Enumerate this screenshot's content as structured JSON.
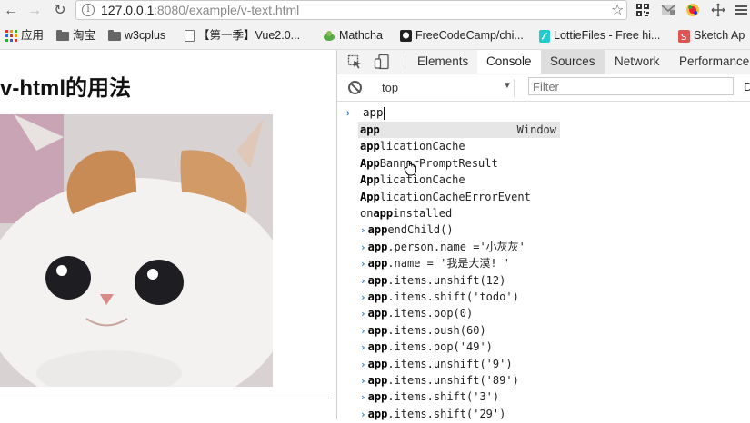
{
  "toolbar": {
    "back_glyph": "←",
    "forward_glyph": "→",
    "reload_glyph": "↻",
    "info_glyph": "i",
    "url_host": "127.0.0.1",
    "url_rest": ":8080/example/v-text.html",
    "star_glyph": "☆",
    "extensions": [
      "qr-code-icon",
      "gmail-icon",
      "color-picker-icon",
      "move-icon",
      "menu-icon"
    ]
  },
  "bookmarks": [
    {
      "label": "应用",
      "icon": "apps-grid-icon"
    },
    {
      "label": "淘宝",
      "icon": "folder-icon"
    },
    {
      "label": "w3cplus",
      "icon": "folder-icon"
    },
    {
      "label": "【第一季】Vue2.0...",
      "icon": "page-icon"
    },
    {
      "label": "Mathcha",
      "icon": "mathcha-icon"
    },
    {
      "label": "FreeCodeCamp/chi...",
      "icon": "github-icon"
    },
    {
      "label": "LottieFiles - Free hi...",
      "icon": "lottie-icon"
    },
    {
      "label": "Sketch Ap",
      "icon": "sketch-icon"
    }
  ],
  "page": {
    "title": "v-html的用法",
    "image_alt": "cat-photo"
  },
  "devtools": {
    "tabs": [
      "Elements",
      "Console",
      "Sources",
      "Network",
      "Performance"
    ],
    "active_tab": "Console",
    "context": "top",
    "filter_placeholder": "Filter",
    "filter_more": "D",
    "prompt_glyph": "›",
    "console_input": "app",
    "autocomplete": [
      {
        "pre": "app",
        "post": "",
        "hint": "Window",
        "arrow": false,
        "selected": true
      },
      {
        "pre": "app",
        "post": "licationCache",
        "arrow": false
      },
      {
        "pre": "App",
        "post": "BannerPromptResult",
        "arrow": false
      },
      {
        "pre": "App",
        "post": "licationCache",
        "arrow": false
      },
      {
        "pre": "App",
        "post": "licationCacheErrorEvent",
        "arrow": false
      },
      {
        "pre0": "on",
        "pre": "app",
        "post": "installed",
        "arrow": false
      },
      {
        "pre": "app",
        "post": "endChild()",
        "arrow": true
      },
      {
        "pre": "app",
        "post": ".person.name ='小灰灰'",
        "arrow": true
      },
      {
        "pre": "app",
        "post": ".name = '我是大漠! '",
        "arrow": true
      },
      {
        "pre": "app",
        "post": ".items.unshift(12)",
        "arrow": true
      },
      {
        "pre": "app",
        "post": ".items.shift('todo')",
        "arrow": true
      },
      {
        "pre": "app",
        "post": ".items.pop(0)",
        "arrow": true
      },
      {
        "pre": "app",
        "post": ".items.push(60)",
        "arrow": true
      },
      {
        "pre": "app",
        "post": ".items.pop('49')",
        "arrow": true
      },
      {
        "pre": "app",
        "post": ".items.unshift('9')",
        "arrow": true
      },
      {
        "pre": "app",
        "post": ".items.unshift('89')",
        "arrow": true
      },
      {
        "pre": "app",
        "post": ".items.shift('3')",
        "arrow": true
      },
      {
        "pre": "app",
        "post": ".items.shift('29')",
        "arrow": true
      }
    ]
  }
}
